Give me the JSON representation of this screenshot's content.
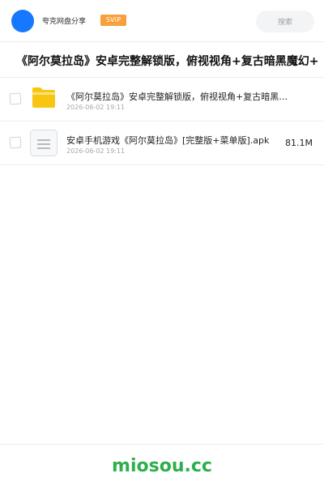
{
  "header": {
    "app_name": "夸克网盘分享",
    "badge": "SVIP",
    "search_placeholder": "搜索",
    "avatar_color": "#1677ff",
    "badge_color": "#f7a03c"
  },
  "title": "《阿尔莫拉岛》安卓完整解锁版，俯视视角+复古暗黑魔幻+",
  "files": [
    {
      "icon": "folder-icon",
      "name": "《阿尔莫拉岛》安卓完整解锁版，俯视视角+复古暗黑魔幻…",
      "date": "2026-06-02 19:11",
      "size": ""
    },
    {
      "icon": "document-icon",
      "name": "安卓手机游戏《阿尔莫拉岛》[完整版+菜单版].apk",
      "date": "2026-06-02 19:11",
      "size": "81.1M"
    }
  ],
  "footer": {
    "brand": "miosou.cc",
    "brand_color": "#2fae4c"
  }
}
